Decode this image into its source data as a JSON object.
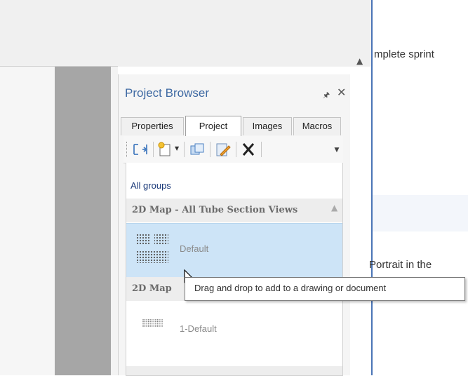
{
  "background": {
    "right_text_top": "mplete sprint",
    "right_text_mid": "Portrait in the"
  },
  "panel": {
    "title": "Project Browser",
    "pin_icon": "pin-icon",
    "close_icon": "close-icon",
    "tabs": [
      {
        "label": "Properties",
        "active": false
      },
      {
        "label": "Project",
        "active": true
      },
      {
        "label": "Images",
        "active": false
      },
      {
        "label": "Macros",
        "active": false
      }
    ],
    "toolbar": {
      "buttons": [
        "link-icon",
        "new-item-icon",
        "copy-icon",
        "edit-icon",
        "delete-icon"
      ]
    },
    "list": {
      "all_groups_label": "All groups",
      "groups": [
        {
          "label": "2D Map - All Tube Section Views",
          "items": [
            {
              "label": "Default",
              "selected": true
            }
          ]
        },
        {
          "label": "2D Map",
          "items": [
            {
              "label": "1-Default",
              "selected": false
            }
          ]
        }
      ]
    }
  },
  "tooltip": {
    "text": "Drag and drop to add to a drawing or document"
  },
  "colors": {
    "accent": "#3f6aa3",
    "selection": "#cde4f7",
    "divider": "#4a74b6"
  }
}
